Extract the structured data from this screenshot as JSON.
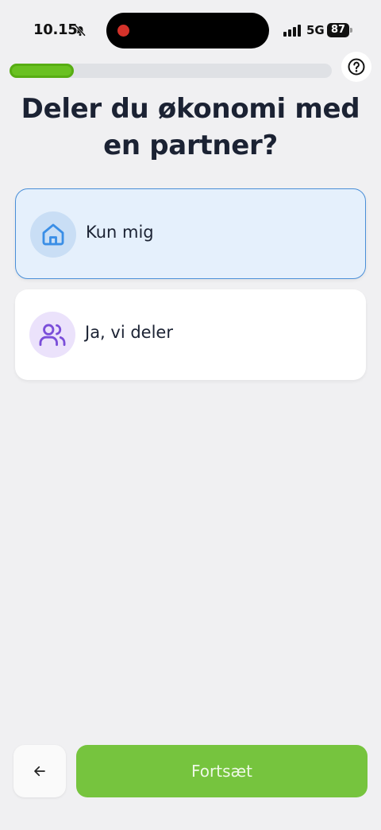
{
  "status_bar": {
    "time": "10.15",
    "network": "5G",
    "battery": "87"
  },
  "progress": {
    "fraction": 0.2
  },
  "question": {
    "title": "Deler du økonomi med en partner?"
  },
  "options": [
    {
      "label": "Kun mig",
      "icon": "house-icon",
      "selected": true
    },
    {
      "label": "Ja, vi deler",
      "icon": "users-icon",
      "selected": false
    }
  ],
  "footer": {
    "continue_label": "Fortsæt",
    "back_icon": "arrow-left-icon"
  },
  "colors": {
    "accent_green": "#76c43e",
    "progress_green": "#69c121",
    "selected_blue": "#4a8fd8",
    "icon_purple": "#7a4ed9"
  }
}
